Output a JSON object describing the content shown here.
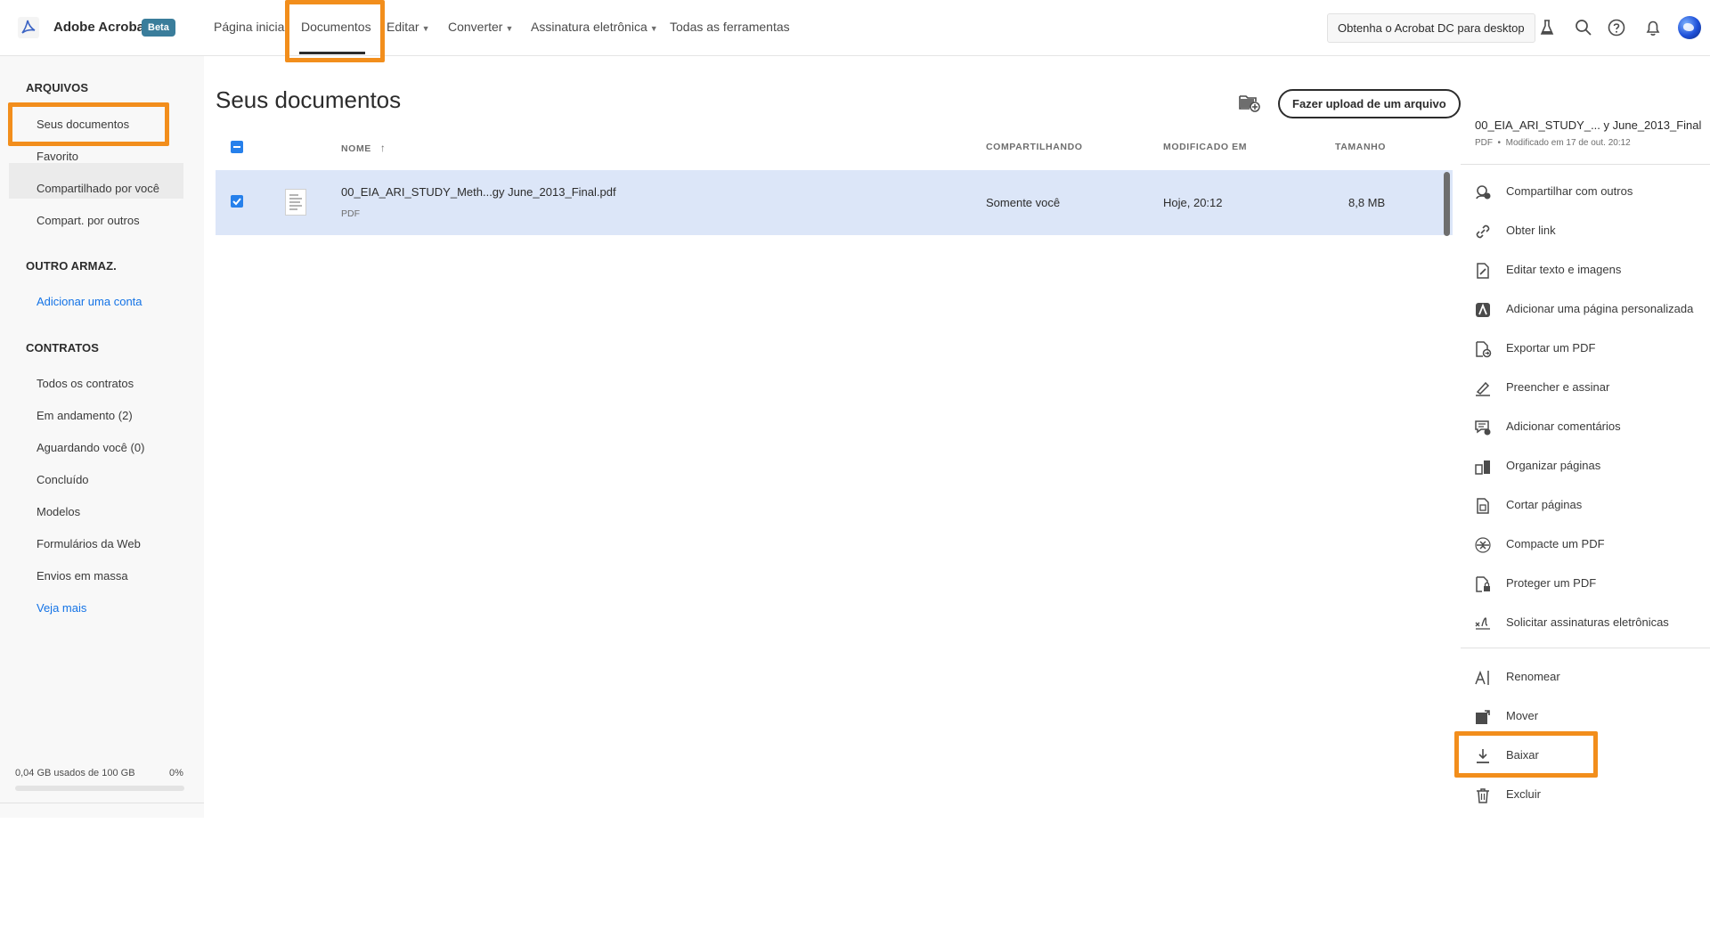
{
  "topbar": {
    "brand": "Adobe Acrobat",
    "beta": "Beta",
    "nav": [
      "Página inicial",
      "Documentos",
      "Editar",
      "Converter",
      "Assinatura eletrônica",
      "Todas as ferramentas"
    ],
    "get_desktop": "Obtenha o Acrobat DC para desktop"
  },
  "sidebar": {
    "files_head": "ARQUIVOS",
    "files": [
      "Seus documentos",
      "Favorito",
      "Compartilhado por você",
      "Compart. por outros"
    ],
    "storage_head": "OUTRO ARMAZ.",
    "add_account": "Adicionar uma conta",
    "contracts_head": "CONTRATOS",
    "contracts": [
      "Todos os contratos",
      "Em andamento (2)",
      "Aguardando você (0)",
      "Concluído",
      "Modelos",
      "Formulários da Web",
      "Envios em massa"
    ],
    "see_more": "Veja mais",
    "usage": "0,04 GB usados de 100 GB",
    "usage_pct": "0%",
    "usage_fraction": 0.0
  },
  "main": {
    "title": "Seus documentos",
    "upload": "Fazer upload de um arquivo",
    "columns": {
      "name": "NOME",
      "sharing": "COMPARTILHANDO",
      "modified": "MODIFICADO EM",
      "size": "TAMANHO"
    },
    "rows": [
      {
        "name": "00_EIA_ARI_STUDY_Meth...gy June_2013_Final.pdf",
        "type": "PDF",
        "sharing": "Somente você",
        "modified": "Hoje, 20:12",
        "size": "8,8 MB"
      }
    ]
  },
  "panel": {
    "title": "00_EIA_ARI_STUDY_...  y June_2013_Final",
    "type": "PDF",
    "modified": "Modificado em  17 de out. 20:12",
    "actions": [
      "Compartilhar com outros",
      "Obter link",
      "Editar texto e imagens",
      "Adicionar uma página personalizada",
      "Exportar um PDF",
      "Preencher e assinar",
      "Adicionar comentários",
      "Organizar páginas",
      "Cortar páginas",
      "Compacte um PDF",
      "Proteger um PDF",
      "Solicitar assinaturas eletrônicas"
    ],
    "file_actions": [
      "Renomear",
      "Mover",
      "Baixar",
      "Excluir"
    ]
  },
  "colors": {
    "accent": "#1473e6",
    "highlight": "#f28e1c",
    "selected_row": "#dce6f8",
    "beta": "#3a7d9b"
  }
}
